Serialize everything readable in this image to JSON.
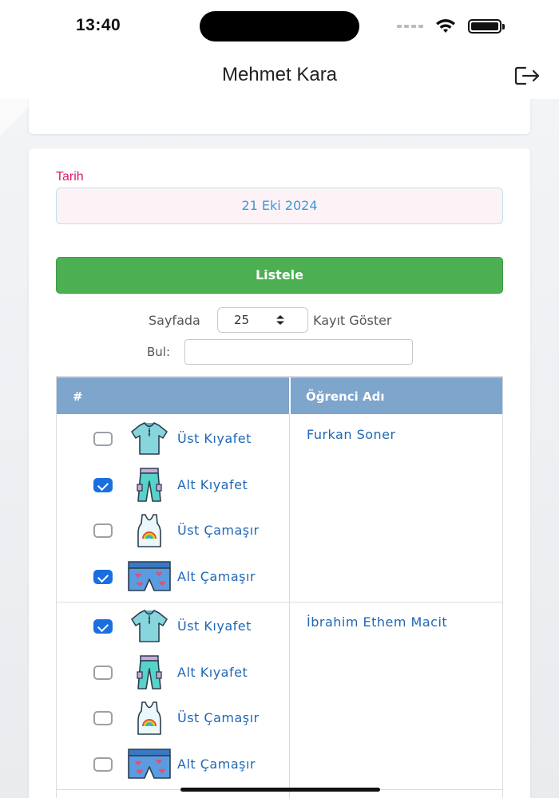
{
  "status": {
    "time": "13:40"
  },
  "nav": {
    "title": "Mehmet Kara"
  },
  "filter": {
    "date_label": "Tarih",
    "date_value": "21 Eki 2024",
    "list_button": "Listele",
    "per_page_prefix": "Sayfada",
    "per_page_value": "25",
    "per_page_suffix": "Kayıt Göster",
    "find_label": "Bul:",
    "find_value": ""
  },
  "table": {
    "headers": [
      "#",
      "Öğrenci Adı"
    ],
    "students": [
      {
        "name": "Furkan Soner",
        "items": [
          {
            "label": "Üst Kıyafet",
            "checked": false,
            "icon": "shirt-icon"
          },
          {
            "label": "Alt Kıyafet",
            "checked": true,
            "icon": "pants-icon"
          },
          {
            "label": "Üst Çamaşır",
            "checked": false,
            "icon": "undershirt-icon"
          },
          {
            "label": "Alt Çamaşır",
            "checked": true,
            "icon": "underwear-icon"
          }
        ]
      },
      {
        "name": "İbrahim Ethem Macit",
        "items": [
          {
            "label": "Üst Kıyafet",
            "checked": true,
            "icon": "shirt-icon"
          },
          {
            "label": "Alt Kıyafet",
            "checked": false,
            "icon": "pants-icon"
          },
          {
            "label": "Üst Çamaşır",
            "checked": false,
            "icon": "undershirt-icon"
          },
          {
            "label": "Alt Çamaşır",
            "checked": false,
            "icon": "underwear-icon"
          }
        ]
      }
    ]
  },
  "colors": {
    "accent_green": "#4cb052",
    "header_blue": "#7ea5cb",
    "link_blue": "#1f67b5",
    "label_pink": "#e0186c",
    "checkbox_blue": "#1a6fe0"
  }
}
